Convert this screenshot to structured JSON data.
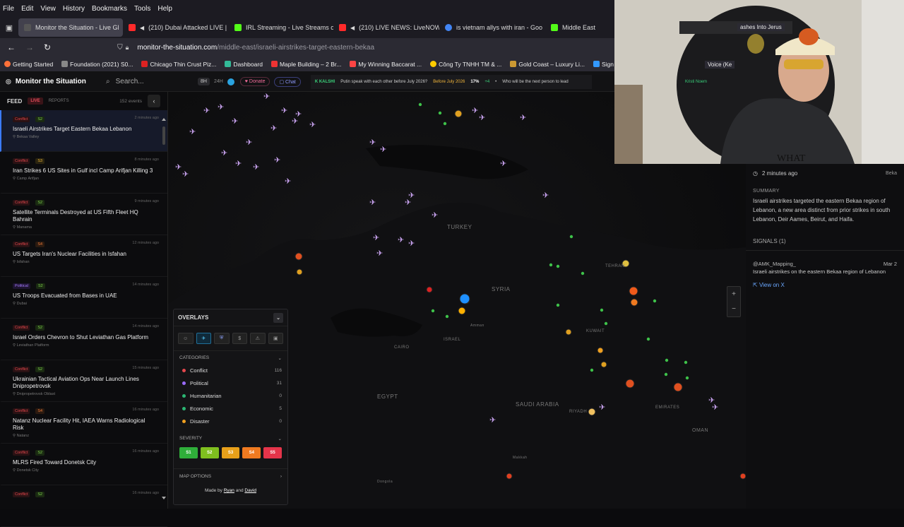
{
  "browser": {
    "menu": [
      "File",
      "Edit",
      "View",
      "History",
      "Bookmarks",
      "Tools",
      "Help"
    ],
    "tabs": [
      {
        "label": "Monitor the Situation - Live Gl",
        "color": "#555"
      },
      {
        "label": "(210) Dubai Attacked LIVE |",
        "color": "#ff2a2a"
      },
      {
        "label": "IRL Streaming - Live Streams o",
        "color": "#53fc18"
      },
      {
        "label": "(210) LIVE NEWS: LiveNOW",
        "color": "#ff2a2a"
      },
      {
        "label": "is vietnam allys with iran - Goo",
        "color": "#4285f4"
      },
      {
        "label": "Middle East",
        "color": "#53fc18"
      }
    ],
    "url_domain": "monitor-the-situation.com",
    "url_path": "/middle-east/israeli-airstrikes-target-eastern-bekaa",
    "bookmarks": [
      {
        "label": "Getting Started",
        "color": "#ff7139"
      },
      {
        "label": "Foundation (2021) S0...",
        "color": "#888"
      },
      {
        "label": "Chicago Thin Crust Piz...",
        "color": "#d22"
      },
      {
        "label": "Dashboard",
        "color": "#3b9"
      },
      {
        "label": "Maple Building – 2 Br...",
        "color": "#e33"
      },
      {
        "label": "My Winning Baccarat ...",
        "color": "#f44"
      },
      {
        "label": "Công Ty TNHH TM & ...",
        "color": "#fc0"
      },
      {
        "label": "Gold Coast – Luxury Li...",
        "color": "#c93"
      },
      {
        "label": "Sign in - Drea",
        "color": "#39f"
      }
    ]
  },
  "app": {
    "brand": "Monitor the Situation",
    "search_placeholder": "Search...",
    "range_8h": "8H",
    "range_24h": "24H",
    "donate": "Donate",
    "chat": "Chat",
    "ticker_kalshi": "KALSHI",
    "ticker_text1": "Putin speak with each other before July 2026?",
    "ticker_hl": "Before July 2026",
    "ticker_pct": "17%",
    "ticker_delta": "+4",
    "ticker_text2": "Who will be the next person to lead"
  },
  "feed": {
    "title": "FEED",
    "live": "LIVE",
    "reports": "REPORTS",
    "count": "152 events",
    "items": [
      {
        "cat": "Conflict",
        "sev": "S2",
        "time": "2 minutes ago",
        "title": "Israeli Airstrikes Target Eastern Bekaa Lebanon",
        "loc": "Bekaa Valley"
      },
      {
        "cat": "Conflict",
        "sev": "S3",
        "time": "8 minutes ago",
        "title": "Iran Strikes 6 US Sites in Gulf incl Camp Arifjan Killing 3",
        "loc": "Camp Arifjan"
      },
      {
        "cat": "Conflict",
        "sev": "S2",
        "time": "9 minutes ago",
        "title": "Satellite Terminals Destroyed at US Fifth Fleet HQ Bahrain",
        "loc": "Manama"
      },
      {
        "cat": "Conflict",
        "sev": "S4",
        "time": "12 minutes ago",
        "title": "US Targets Iran's Nuclear Facilities in Isfahan",
        "loc": "Isfahan"
      },
      {
        "cat": "Political",
        "sev": "S2",
        "time": "14 minutes ago",
        "title": "US Troops Evacuated from Bases in UAE",
        "loc": "Dubai"
      },
      {
        "cat": "Conflict",
        "sev": "S2",
        "time": "14 minutes ago",
        "title": "Israel Orders Chevron to Shut Leviathan Gas Platform",
        "loc": "Leviathan Platform"
      },
      {
        "cat": "Conflict",
        "sev": "S2",
        "time": "15 minutes ago",
        "title": "Ukrainian Tactical Aviation Ops Near Launch Lines Dnipropetrovsk",
        "loc": "Dnipropetrovsk Oblast"
      },
      {
        "cat": "Conflict",
        "sev": "S4",
        "time": "16 minutes ago",
        "title": "Natanz Nuclear Facility Hit, IAEA Warns Radiological Risk",
        "loc": "Natanz"
      },
      {
        "cat": "Conflict",
        "sev": "S2",
        "time": "16 minutes ago",
        "title": "MLRS Fired Toward Donetsk City",
        "loc": "Donetsk City"
      },
      {
        "cat": "Conflict",
        "sev": "S2",
        "time": "16 minutes ago",
        "title": "",
        "loc": ""
      }
    ]
  },
  "overlays": {
    "title": "OVERLAYS",
    "categories_label": "CATEGORIES",
    "categories": [
      {
        "name": "Conflict",
        "count": "116",
        "color": "#e5484d"
      },
      {
        "name": "Political",
        "count": "31",
        "color": "#9b6bff"
      },
      {
        "name": "Humanitarian",
        "count": "0",
        "color": "#2bb673"
      },
      {
        "name": "Economic",
        "count": "5",
        "color": "#2bb673"
      },
      {
        "name": "Disaster",
        "count": "0",
        "color": "#f0a020"
      }
    ],
    "severity_label": "SEVERITY",
    "severity": [
      {
        "label": "S1",
        "color": "#2fae3a"
      },
      {
        "label": "S2",
        "color": "#7fbf1f"
      },
      {
        "label": "S3",
        "color": "#e8a01a"
      },
      {
        "label": "S4",
        "color": "#f07a20"
      },
      {
        "label": "S5",
        "color": "#e5344a"
      }
    ],
    "map_options": "MAP OPTIONS",
    "made_by": "Made by",
    "author1": "Ryan",
    "and": "and",
    "author2": "David"
  },
  "map_labels": [
    "TURKEY",
    "SYRIA",
    "ISRAEL",
    "EGYPT",
    "SAUDI ARABIA",
    "TEHRAN",
    "KUWAIT",
    "RIYADH",
    "OMAN",
    "EMIRATES",
    "CAIRO",
    "Amman",
    "Makkah",
    "Dongola"
  ],
  "details": {
    "time": "2 minutes ago",
    "right": "Beka",
    "summary_label": "SUMMARY",
    "summary": "Israeli airstrikes targeted the eastern Bekaa region of Lebanon, a new area distinct from prior strikes in south Lebanon, Deir Aames, Beirut, and Haifa.",
    "signals": "SIGNALS (1)",
    "source": "@AMK_Mapping_",
    "source_date": "Mar 2",
    "source_text": "Israeli airstrikes on the eastern Bekaa region of Lebanon",
    "view": "View on X"
  },
  "webcam": {
    "tab1": "ashes Into Jerus",
    "tab2": "Voice (Ke",
    "tab3": "Kristi Noem"
  },
  "colors": {
    "accent": "#3b7bff",
    "conflict": "#e5484d",
    "political": "#9b6bff"
  }
}
